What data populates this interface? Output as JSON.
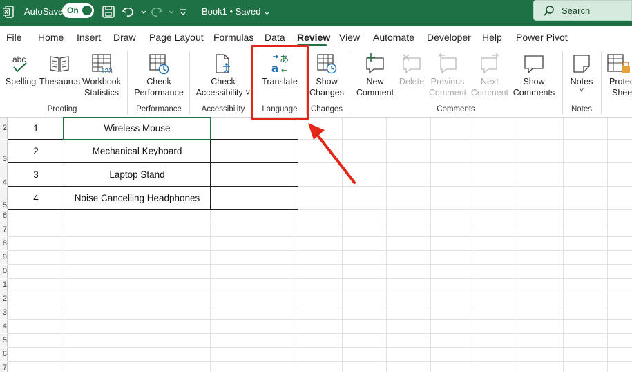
{
  "titlebar": {
    "autosave_label": "AutoSave",
    "autosave_state": "On",
    "book_title": "Book1 • Saved ⌄",
    "search_label": "Search",
    "brand_color": "#1e7145"
  },
  "tabs": [
    "File",
    "Home",
    "Insert",
    "Draw",
    "Page Layout",
    "Formulas",
    "Data",
    "Review",
    "View",
    "Automate",
    "Developer",
    "Help",
    "Power Pivot"
  ],
  "active_tab": "Review",
  "ribbon": {
    "spelling": "Spelling",
    "spelling_icon_text": "abc",
    "thesaurus": "Thesaurus",
    "workbook_statistics_1": "Workbook",
    "workbook_statistics_2": "Statistics",
    "workbook_stats_icon_text": "123",
    "check_performance_1": "Check",
    "check_performance_2": "Performance",
    "check_accessibility_1": "Check",
    "check_accessibility_2": "Accessibility ˅",
    "translate": "Translate",
    "show_changes_1": "Show",
    "show_changes_2": "Changes",
    "new_comment_1": "New",
    "new_comment_2": "Comment",
    "delete": "Delete",
    "previous_comment_1": "Previous",
    "previous_comment_2": "Comment",
    "next_comment_1": "Next",
    "next_comment_2": "Comment",
    "show_comments_1": "Show",
    "show_comments_2": "Comments",
    "notes": "Notes",
    "notes_chevron": "˅",
    "protect_sheet_1": "Protec",
    "protect_sheet_2": "Sheet",
    "groups": {
      "proofing": "Proofing",
      "performance": "Performance",
      "accessibility": "Accessibility",
      "language": "Language",
      "changes": "Changes",
      "comments": "Comments",
      "notes": "Notes"
    }
  },
  "row_numbers": [
    "2",
    "3",
    "4",
    "5",
    "6",
    "7",
    "8",
    "9",
    "0",
    "1",
    "2",
    "3",
    "4",
    "5",
    "6",
    "7"
  ],
  "table": {
    "rows": [
      {
        "num": "1",
        "item": "Wireless Mouse"
      },
      {
        "num": "2",
        "item": "Mechanical Keyboard"
      },
      {
        "num": "3",
        "item": "Laptop Stand"
      },
      {
        "num": "4",
        "item": "Noise Cancelling Headphones"
      }
    ]
  },
  "annotation_color": "#e32617"
}
